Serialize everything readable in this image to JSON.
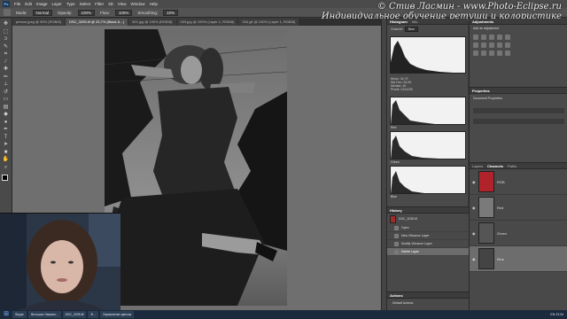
{
  "menubar": {
    "logo": "Ps",
    "items": [
      "File",
      "Edit",
      "Image",
      "Layer",
      "Type",
      "Select",
      "Filter",
      "3D",
      "View",
      "Window",
      "Help"
    ]
  },
  "options": {
    "mode_label": "Mode:",
    "mode_value": "Normal",
    "opacity_label": "Opacity:",
    "opacity_value": "100%",
    "flow_label": "Flow:",
    "flow_value": "100%",
    "smoothing_label": "Smoothing:",
    "smoothing_value": "10%"
  },
  "watermark": {
    "line1": "© Стив Ласмин - www.Photo-Eclipse.ru",
    "line2": "Индивидуальное обучение ретуши и колористике"
  },
  "tabs": [
    {
      "label": "person.jpeg @ 50% (RGB/8)"
    },
    {
      "label": "DSC_3295.tif @ 33,7% (Black &...)",
      "active": true
    },
    {
      "label": "002.jpg @ 100% (RGB/8)"
    },
    {
      "label": "003.jpg @ 100% (Layer 1, RGB/8)"
    },
    {
      "label": "004.gif @ 100% (Layer 1, RGB/8)"
    }
  ],
  "panels": {
    "histogram_tabs": [
      "Histogram",
      "Info"
    ],
    "channel_value": "Blue",
    "stats": [
      "Mean: 34,79",
      "Std Dev: 26,95",
      "Median: 30",
      "Pixels: 2224230"
    ],
    "hist_labels": [
      "Red",
      "Green",
      "Blue"
    ],
    "adjustments_tabs": [
      "Adjustments"
    ],
    "adjustments_title": "Add an adjustment",
    "properties_tab": "Properties",
    "properties_title": "Document Properties",
    "channels_tabs": [
      "Layers",
      "Channels",
      "Paths"
    ],
    "channels": [
      {
        "name": "RGB",
        "color": "#b0232a"
      },
      {
        "name": "Red",
        "color": "#7a7a7a"
      },
      {
        "name": "Green",
        "color": "#555555"
      },
      {
        "name": "Blue",
        "color": "#444444",
        "selected": true
      }
    ],
    "history_tabs": [
      "History"
    ],
    "history_snapshot": "DSC_3295.tif",
    "history_items": [
      {
        "label": "Open"
      },
      {
        "label": "New Vibrance Layer"
      },
      {
        "label": "Modify Vibrance Layer"
      },
      {
        "label": "Delete Layer",
        "selected": true
      }
    ],
    "actions_tab": "Actions",
    "actions_item": "Default Actions"
  },
  "taskbar": {
    "items": [
      "Skype",
      "Фотошоп Ласмин...",
      "DSC_3295.tif",
      "Ф...",
      "Управление цветом"
    ],
    "clock": "23:34",
    "lang": "EN"
  }
}
